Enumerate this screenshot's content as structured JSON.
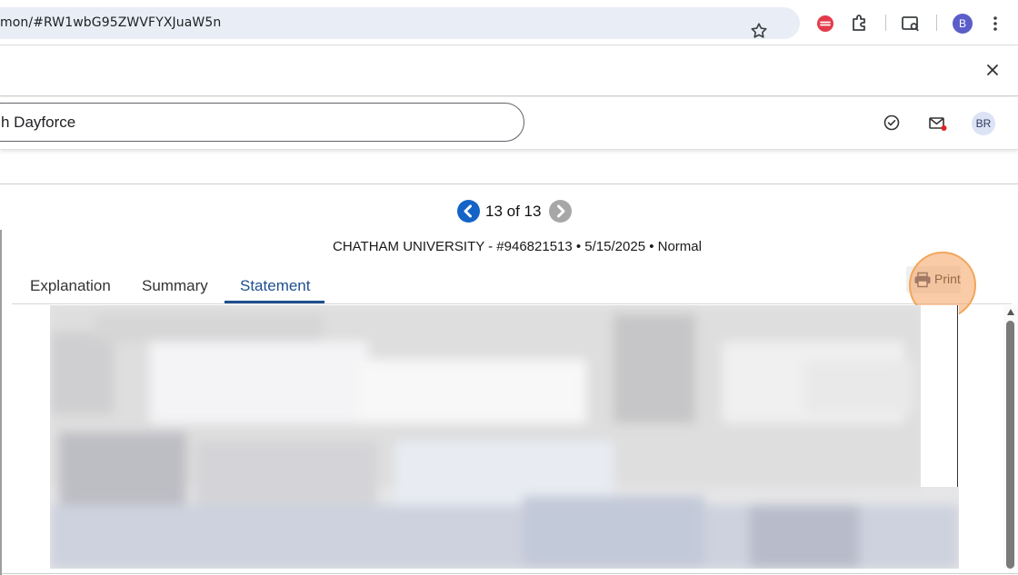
{
  "browser": {
    "url": "mon/#RW1wbG95ZWVFYXJuaW5n",
    "profile_initial": "B",
    "icons": [
      "star-icon",
      "extension-red-icon",
      "puzzle-icon",
      "tab-search-icon",
      "more-vert-icon"
    ]
  },
  "app": {
    "search_value": "h Dayforce",
    "avatar_initials": "BR"
  },
  "statement": {
    "pager_text": "13 of 13",
    "subtitle": "CHATHAM UNIVERSITY - #946821513 • 5/15/2025 • Normal",
    "tabs": [
      {
        "label": "Explanation",
        "active": false
      },
      {
        "label": "Summary",
        "active": false
      },
      {
        "label": "Statement",
        "active": true
      }
    ],
    "print_label": "Print"
  },
  "colors": {
    "accent": "#1f4f8f",
    "nav_active": "#1463c6",
    "nav_disabled": "#a7a7a7",
    "highlight": "#f2a65a"
  }
}
